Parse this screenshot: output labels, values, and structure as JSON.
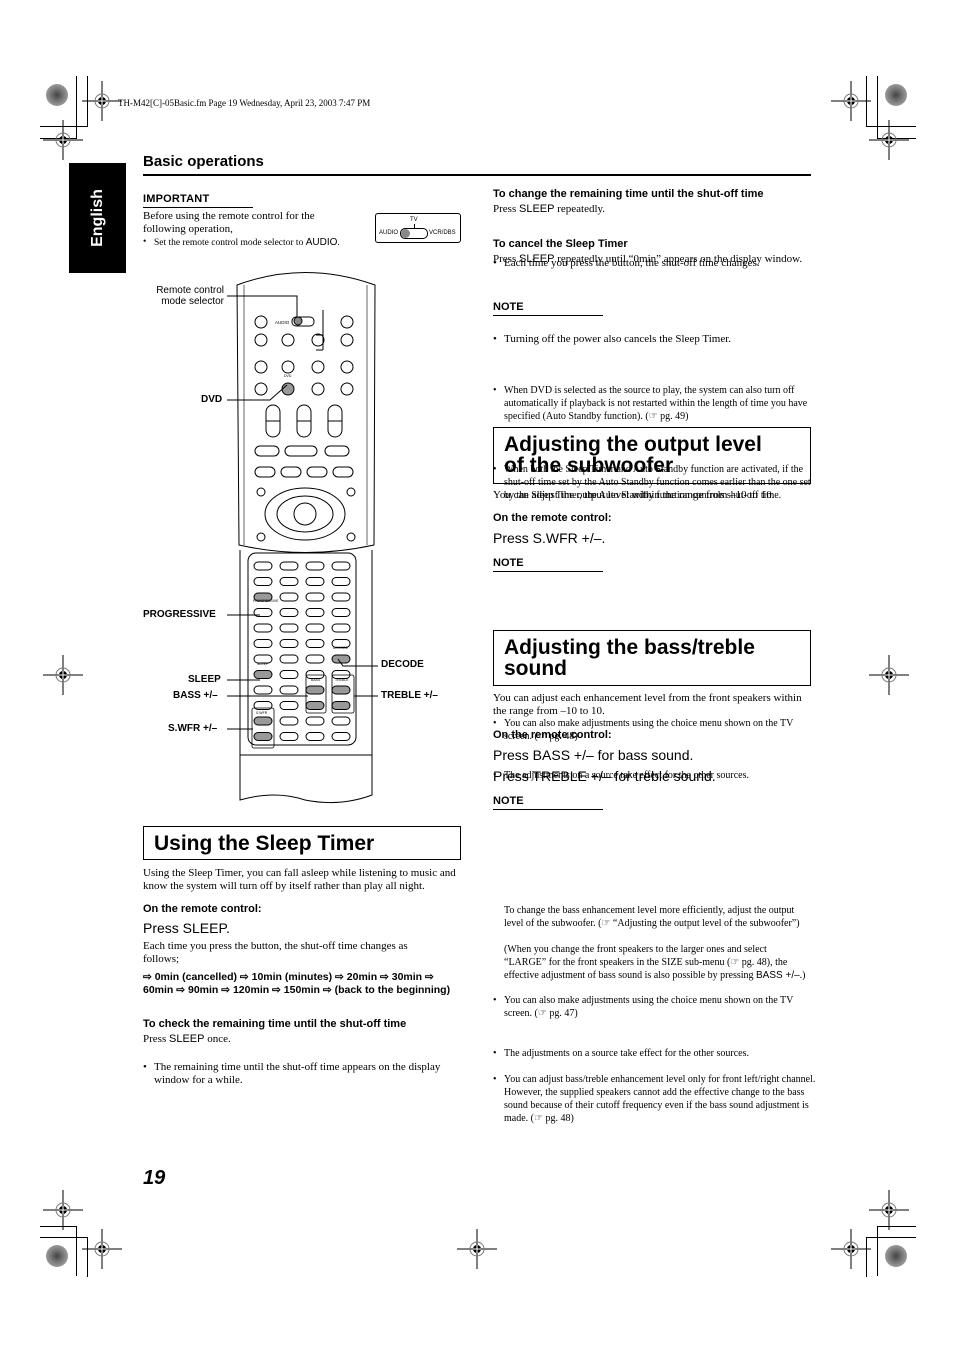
{
  "file_info": "TH-M42[C]-05Basic.fm  Page 19  Wednesday, April 23, 2003  7:47 PM",
  "language_tab": "English",
  "section_header": "Basic operations",
  "important": {
    "title": "IMPORTANT",
    "text": "Before using the remote control for the following operation,",
    "bullet_prefix": "Set the remote control mode selector to ",
    "bullet_emph": "AUDIO",
    "bullet_suffix": ".",
    "mode_switch": {
      "tv": "TV",
      "left": "AUDIO",
      "right": "VCR/DBS"
    }
  },
  "remote_callouts": {
    "mode_selector": [
      "Remote control",
      "mode selector"
    ],
    "dvd": "DVD",
    "progressive": "PROGRESSIVE",
    "sleep": "SLEEP",
    "bass": "BASS +/–",
    "swfr": "S.WFR +/–",
    "decode": "DECODE",
    "treble": "TREBLE +/–",
    "button_labels": {
      "audio": "AUDIO",
      "dvd": "DVD",
      "progressive": "PROGRESSIVE",
      "sleep": "SLEEP",
      "decode": "DECODE",
      "bass": "BASS",
      "treble": "TREBLE",
      "swfr": "S.WFR"
    }
  },
  "sleep_timer": {
    "heading": "Using the Sleep Timer",
    "intro": "Using the Sleep Timer, you can fall asleep while listening to music and know the system will turn off by itself rather than play all night.",
    "on_remote": "On the remote control:",
    "press": "Press SLEEP.",
    "each_time": "Each time you press the button, the shut-off time changes as follows;",
    "sequence": "⇨ 0min (cancelled) ⇨ 10min (minutes) ⇨ 20min ⇨ 30min ⇨ 60min ⇨ 90min ⇨ 120min ⇨ 150min ⇨ (back to the beginning)",
    "check": {
      "title": "To check the remaining time until the shut-off time",
      "press_prefix": "Press ",
      "press_key": "SLEEP",
      "press_suffix": " once.",
      "bullet": "The remaining time until the shut-off time appears on the display window for a while."
    },
    "change": {
      "title": "To change the remaining time until the shut-off time",
      "press_prefix": "Press ",
      "press_key": "SLEEP",
      "press_suffix": " repeatedly.",
      "bullet": "Each time you press the button, the shut-off time changes."
    },
    "cancel": {
      "title": "To cancel the Sleep Timer",
      "press_prefix": "Press ",
      "press_key": "SLEEP",
      "press_suffix": " repeatedly until “0min” appears on the display window.",
      "bullet": "Turning off the power also cancels the Sleep Timer."
    },
    "note_title": "NOTE",
    "notes": [
      "When DVD is selected as the source to play, the system can also turn off automatically if playback is not restarted within the length of time you have specified (Auto Standby function). (☞ pg. 49)",
      "When both the Sleep Timer and Auto Standby function are activated, if the shut-off time set by the Auto Standby function comes earlier than the one set by the Sleep Timer, the Auto Standby function controls shut-off time."
    ]
  },
  "subwoofer": {
    "heading_line1": "Adjusting the output level",
    "heading_line2": "of the subwoofer",
    "intro": "You can adjust the output level within the range from –10 to 10.",
    "on_remote": "On the remote control:",
    "press": "Press S.WFR +/–.",
    "note_title": "NOTE",
    "notes": [
      "You can also make adjustments using the choice menu shown on the TV screen. (☞ pg. 48)",
      "The adjustments on a source take effect for the other sources."
    ]
  },
  "bass_treble": {
    "heading_line1": "Adjusting the bass/treble",
    "heading_line2": "sound",
    "intro": "You can adjust each enhancement level from the front speakers within the range from –10 to 10.",
    "on_remote": "On the remote control:",
    "press_bass": "Press BASS +/– for bass sound.",
    "press_treble": "Press TREBLE +/– for treble sound.",
    "note_title": "NOTE",
    "notes": [
      "You can also make adjustments using the choice menu shown on the TV screen. (☞ pg. 47)",
      "The adjustments on a source take effect for the other sources.",
      "You can adjust bass/treble enhancement level only for front left/right channel. However, the supplied speakers cannot add the effective change to the bass sound because of their cutoff frequency even if the bass sound adjustment is made. (☞ pg. 48)"
    ],
    "note3_cont1": "To change the bass enhancement level more efficiently, adjust the output level of the subwoofer. (☞ “Adjusting the output level of the subwoofer”)",
    "note3_cont2_prefix": "(When you change the front speakers to the larger ones and select “LARGE” for the front speakers in the SIZE sub-menu (☞ pg. 48), the effective adjustment of bass sound is also possible by pressing ",
    "note3_cont2_key": "BASS +/–",
    "note3_cont2_suffix": ".)"
  },
  "page_number": "19"
}
